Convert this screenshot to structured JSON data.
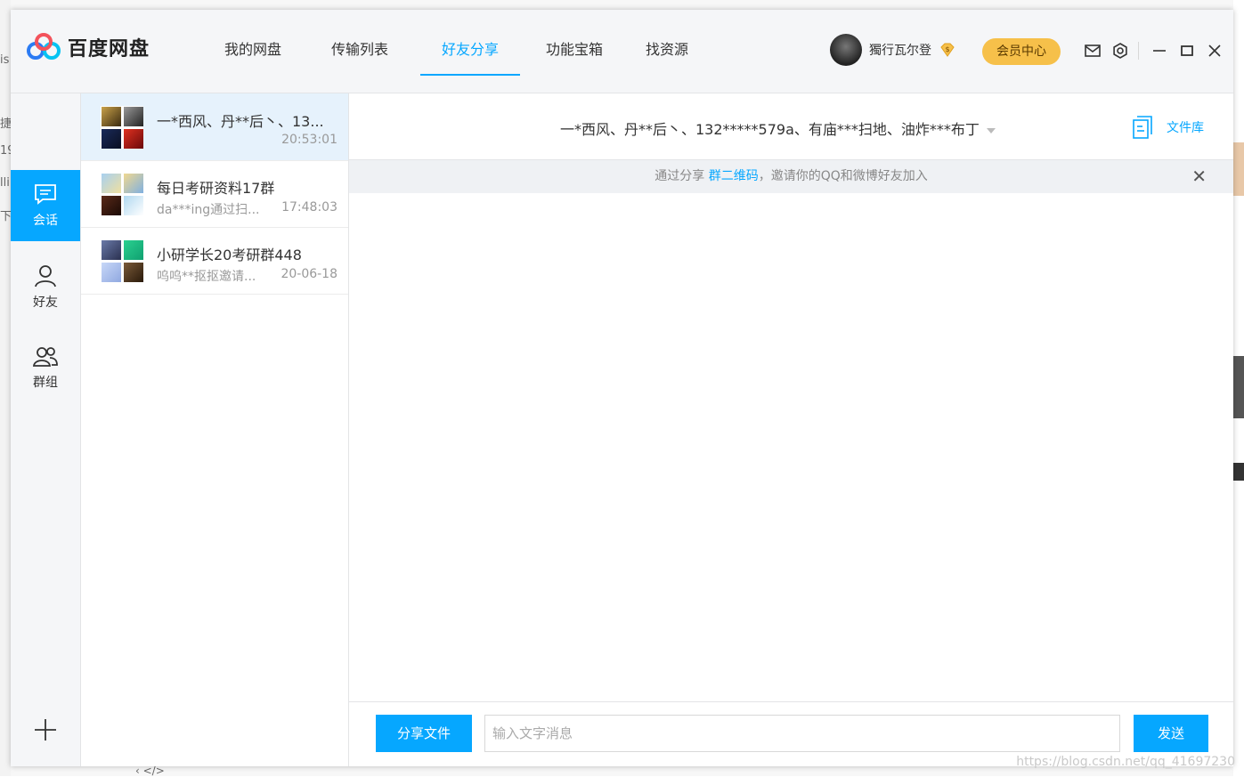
{
  "app": {
    "brand": "百度网盘"
  },
  "nav": {
    "items": [
      {
        "label": "我的网盘"
      },
      {
        "label": "传输列表"
      },
      {
        "label": "好友分享"
      },
      {
        "label": "功能宝箱"
      },
      {
        "label": "找资源"
      }
    ],
    "active_index": 2
  },
  "user": {
    "name": "獨行瓦尔登",
    "member_center": "会员中心"
  },
  "rail": {
    "items": [
      {
        "label": "会话",
        "icon": "chat-icon"
      },
      {
        "label": "好友",
        "icon": "user-icon"
      },
      {
        "label": "群组",
        "icon": "group-icon"
      }
    ]
  },
  "conversations": [
    {
      "name": "一*西风、丹**后丶、13...",
      "sub": "",
      "time": "20:53:01"
    },
    {
      "name": "每日考研资料17群",
      "sub": "da***ing通过扫...",
      "time": "17:48:03"
    },
    {
      "name": "小研学长20考研群448",
      "sub": "呜呜**抠抠邀请...",
      "time": "20-06-18"
    }
  ],
  "chat": {
    "title": "一*西风、丹**后丶、132*****579a、有庙***扫地、油炸***布丁",
    "file_library": "文件库",
    "notice_prefix": "通过分享 ",
    "notice_link": "群二维码",
    "notice_suffix": "，邀请你的QQ和微博好友加入",
    "share_file_button": "分享文件",
    "input_placeholder": "输入文字消息",
    "send_button": "发送"
  },
  "watermark": "https://blog.csdn.net/qq_41697230",
  "colors": {
    "accent": "#06a7ff",
    "member": "#f6c04a"
  }
}
